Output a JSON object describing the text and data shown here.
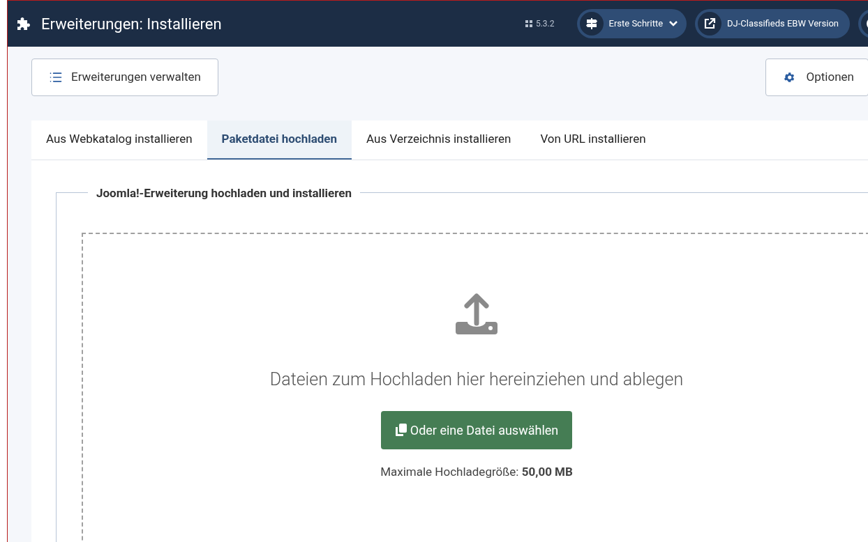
{
  "header": {
    "title": "Erweiterungen: Installieren",
    "version": "5.3.2",
    "buttons": [
      {
        "kind": "menu",
        "label": "Erste Schritte"
      },
      {
        "kind": "link",
        "label": "DJ-Classifieds EBW Version"
      },
      {
        "kind": "user"
      }
    ]
  },
  "toolbar": {
    "left": "Erweiterungen verwalten",
    "right": "Optionen"
  },
  "tabs": [
    {
      "label": "Aus Webkatalog installieren",
      "selected": false
    },
    {
      "label": "Paketdatei hochladen",
      "selected": true
    },
    {
      "label": "Aus Verzeichnis installieren",
      "selected": false
    },
    {
      "label": "Von URL installieren",
      "selected": false
    }
  ],
  "upload": {
    "legend": "Joomla!-Erweiterung hochladen und installieren",
    "drop_text": "Dateien zum Hochladen hier hereinziehen und ablegen",
    "button": "Oder eine Datei auswählen",
    "max_size": "Maximale Hochladegröße: **50,00 MB**"
  }
}
